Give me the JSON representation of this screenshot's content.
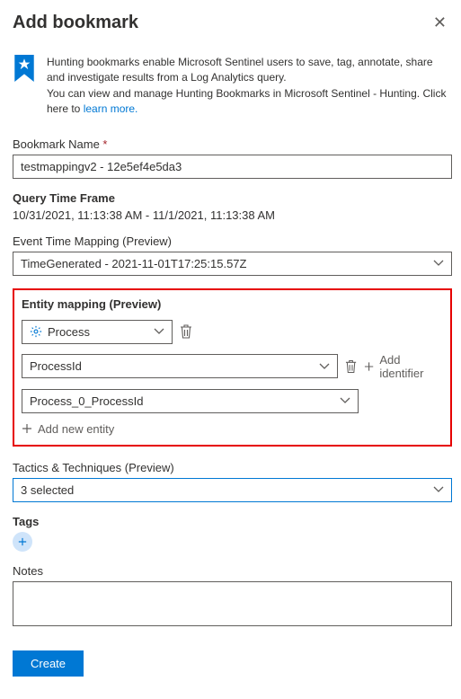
{
  "header": {
    "title": "Add bookmark"
  },
  "intro": {
    "line1": "Hunting bookmarks enable Microsoft Sentinel users to save, tag, annotate, share and investigate results from a Log Analytics query.",
    "line2a": "You can view and manage Hunting Bookmarks in Microsoft Sentinel - Hunting. Click here to ",
    "learn_more": "learn more."
  },
  "bookmark_name": {
    "label": "Bookmark Name",
    "value": "testmappingv2 - 12e5ef4e5da3"
  },
  "query_time": {
    "label": "Query Time Frame",
    "value": "10/31/2021, 11:13:38 AM - 11/1/2021, 11:13:38 AM"
  },
  "event_time": {
    "label": "Event Time Mapping (Preview)",
    "value": "TimeGenerated - 2021-11-01T17:25:15.57Z"
  },
  "entity": {
    "label": "Entity mapping (Preview)",
    "type": "Process",
    "identifier": "ProcessId",
    "value_field": "Process_0_ProcessId",
    "add_identifier": "Add identifier",
    "add_entity": "Add new entity"
  },
  "tactics": {
    "label": "Tactics & Techniques (Preview)",
    "value": "3 selected"
  },
  "tags": {
    "label": "Tags"
  },
  "notes": {
    "label": "Notes"
  },
  "footer": {
    "create": "Create"
  }
}
